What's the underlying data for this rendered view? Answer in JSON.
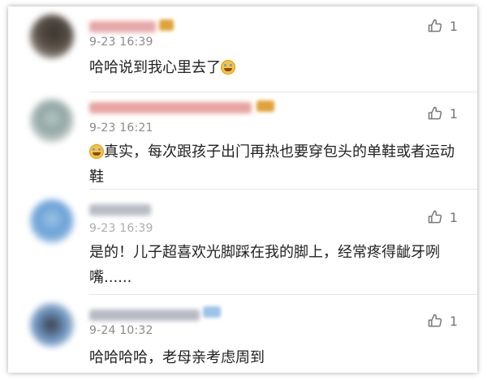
{
  "comments": [
    {
      "time": "9-23 16:39",
      "text_before": "哈哈说到我心里去了",
      "text_after": "",
      "like_count": "1"
    },
    {
      "time": "9-23 16:21",
      "text_before": "",
      "text_after": "真实，每次跟孩子出门再热也要穿包头的单鞋或者运动鞋",
      "like_count": "1"
    },
    {
      "time": "9-23 16:39",
      "text_before": "是的！儿子超喜欢光脚踩在我的脚上，经常疼得龇牙咧嘴......",
      "text_after": "",
      "like_count": "1"
    },
    {
      "time": "9-24 10:32",
      "text_before": "哈哈哈哈，老母亲考虑周到",
      "text_after": "",
      "like_count": "1"
    }
  ],
  "icons": {
    "like": "thumbs-up-icon",
    "emoji": "laughing-emoji-icon"
  },
  "colors": {
    "background": "#ffffff",
    "text": "#222222",
    "meta": "#8a8a8a",
    "divider": "#e5e5e5"
  }
}
